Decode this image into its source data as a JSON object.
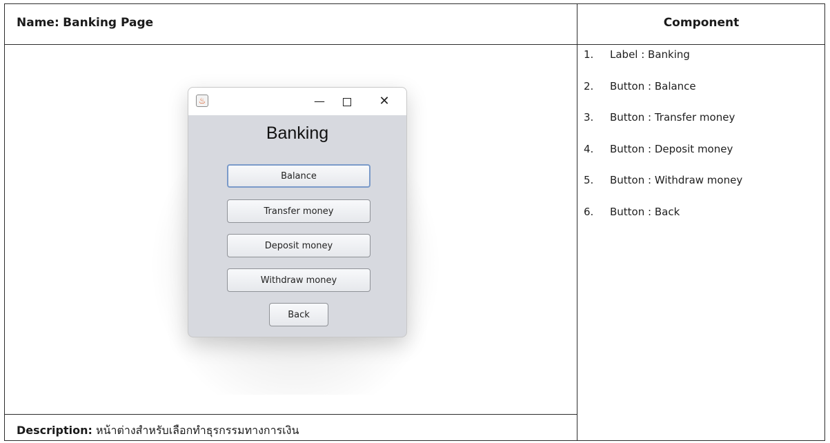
{
  "header": {
    "name_label": "Name:",
    "name_value": "Banking Page",
    "component_heading": "Component"
  },
  "description": {
    "label": "Description:",
    "text": "หน้าต่างสำหรับเลือกทำธุรกรรมทางการเงิน"
  },
  "components": [
    {
      "num": "1.",
      "text": "Label : Banking"
    },
    {
      "num": "2.",
      "text": "Button : Balance"
    },
    {
      "num": "3.",
      "text": "Button : Transfer money"
    },
    {
      "num": "4.",
      "text": "Button : Deposit money"
    },
    {
      "num": "5.",
      "text": "Button : Withdraw money"
    },
    {
      "num": "6.",
      "text": "Button : Back"
    }
  ],
  "window": {
    "title_text": "Banking",
    "icons": {
      "app": "java-icon",
      "minimize": "minimize-icon",
      "maximize": "maximize-icon",
      "close": "close-icon"
    },
    "buttons": {
      "balance": "Balance",
      "transfer": "Transfer money",
      "deposit": "Deposit money",
      "withdraw": "Withdraw money",
      "back": "Back"
    }
  }
}
